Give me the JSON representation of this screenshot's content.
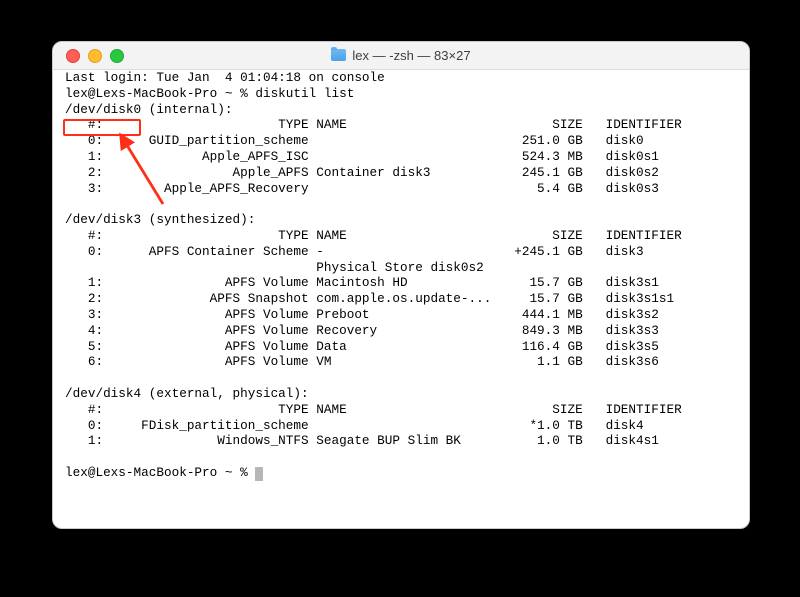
{
  "window_title": "lex — -zsh — 83×27",
  "last_login": "Last login: Tue Jan  4 01:04:18 on console",
  "prompt": "lex@Lexs-MacBook-Pro ~ %",
  "command": "diskutil list",
  "highlight_target": "/dev/disk0",
  "disks": [
    {
      "header": "/dev/disk0 (internal):",
      "col_headers": {
        "num": "#:",
        "type": "TYPE",
        "name": "NAME",
        "size": "SIZE",
        "id": "IDENTIFIER"
      },
      "rows": [
        {
          "num": "0:",
          "type": "GUID_partition_scheme",
          "name": "",
          "size": "251.0 GB",
          "id": "disk0"
        },
        {
          "num": "1:",
          "type": "Apple_APFS_ISC",
          "name": "",
          "size": "524.3 MB",
          "id": "disk0s1"
        },
        {
          "num": "2:",
          "type": "Apple_APFS",
          "name": "Container disk3",
          "size": "245.1 GB",
          "id": "disk0s2"
        },
        {
          "num": "3:",
          "type": "Apple_APFS_Recovery",
          "name": "",
          "size": "5.4 GB",
          "id": "disk0s3"
        }
      ],
      "extra_line": ""
    },
    {
      "header": "/dev/disk3 (synthesized):",
      "col_headers": {
        "num": "#:",
        "type": "TYPE",
        "name": "NAME",
        "size": "SIZE",
        "id": "IDENTIFIER"
      },
      "rows": [
        {
          "num": "0:",
          "type": "APFS Container Scheme",
          "name": "-",
          "size": "+245.1 GB",
          "id": "disk3"
        },
        {
          "num": "1:",
          "type": "APFS Volume",
          "name": "Macintosh HD",
          "size": "15.7 GB",
          "id": "disk3s1"
        },
        {
          "num": "2:",
          "type": "APFS Snapshot",
          "name": "com.apple.os.update-...",
          "size": "15.7 GB",
          "id": "disk3s1s1"
        },
        {
          "num": "3:",
          "type": "APFS Volume",
          "name": "Preboot",
          "size": "444.1 MB",
          "id": "disk3s2"
        },
        {
          "num": "4:",
          "type": "APFS Volume",
          "name": "Recovery",
          "size": "849.3 MB",
          "id": "disk3s3"
        },
        {
          "num": "5:",
          "type": "APFS Volume",
          "name": "Data",
          "size": "116.4 GB",
          "id": "disk3s5"
        },
        {
          "num": "6:",
          "type": "APFS Volume",
          "name": "VM",
          "size": "1.1 GB",
          "id": "disk3s6"
        }
      ],
      "extra_line": "                                 Physical Store disk0s2"
    },
    {
      "header": "/dev/disk4 (external, physical):",
      "col_headers": {
        "num": "#:",
        "type": "TYPE",
        "name": "NAME",
        "size": "SIZE",
        "id": "IDENTIFIER"
      },
      "rows": [
        {
          "num": "0:",
          "type": "FDisk_partition_scheme",
          "name": "",
          "size": "*1.0 TB",
          "id": "disk4"
        },
        {
          "num": "1:",
          "type": "Windows_NTFS",
          "name": "Seagate BUP Slim BK",
          "size": "1.0 TB",
          "id": "disk4s1"
        }
      ],
      "extra_line": ""
    }
  ]
}
